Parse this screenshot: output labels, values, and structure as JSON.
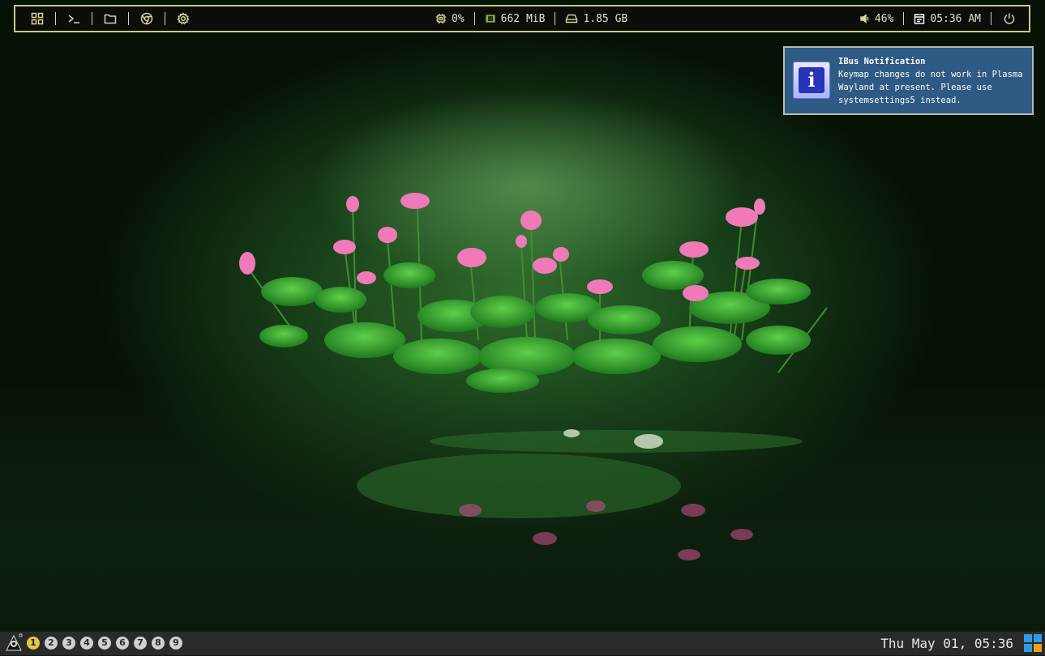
{
  "topbar": {
    "launchers": [
      "apps-grid-icon",
      "terminal-icon",
      "folder-icon",
      "browser-icon",
      "settings-icon"
    ],
    "cpu": "0%",
    "memory": "662 MiB",
    "disk": "1.85 GB",
    "volume": "46%",
    "time": "05:36 AM"
  },
  "notification": {
    "title": "IBus Notification",
    "body": "Keymap changes do not work in Plasma Wayland at present. Please use systemsettings5 instead.",
    "icon": "info-icon"
  },
  "bottombar": {
    "workspaces": [
      "1",
      "2",
      "3",
      "4",
      "5",
      "6",
      "7",
      "8",
      "9"
    ],
    "active_workspace": "1",
    "clock": "Thu May 01, 05:36"
  },
  "colors": {
    "accent": "#d9d49a",
    "notification_bg": "#2f5a84",
    "active_workspace": "#e0c94a"
  }
}
